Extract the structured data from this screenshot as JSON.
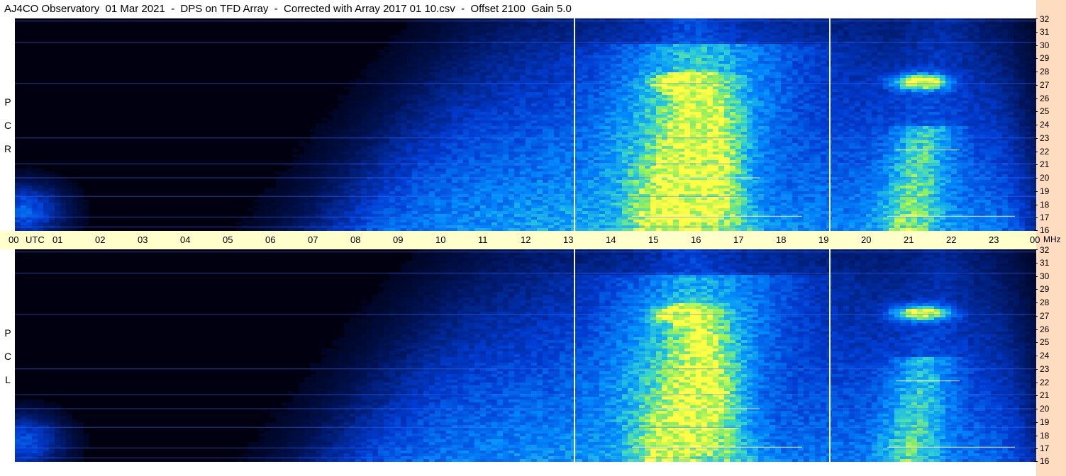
{
  "title": "AJ4CO Observatory  01 Mar 2021  -  DPS on TFD Array  -  Corrected with Array 2017 01 10.csv  -  Offset 2100  Gain 5.0",
  "chart_data": [
    {
      "type": "heatmap",
      "panel": "RCP",
      "polarization_label": [
        "R",
        "C",
        "P"
      ],
      "x_unit": "UTC",
      "x_ticks": [
        "00",
        "01",
        "02",
        "03",
        "04",
        "05",
        "06",
        "07",
        "08",
        "09",
        "10",
        "11",
        "12",
        "13",
        "14",
        "15",
        "16",
        "17",
        "18",
        "19",
        "20",
        "21",
        "22",
        "23",
        "00"
      ],
      "x_range": [
        0,
        24
      ],
      "y_unit": "MHz",
      "y_ticks": [
        32,
        31,
        30,
        29,
        28,
        27,
        26,
        25,
        24,
        23,
        22,
        21,
        20,
        19,
        18,
        17,
        16
      ],
      "y_range": [
        16,
        32
      ],
      "colormap": [
        "#000010",
        "#001a66",
        "#0046d8",
        "#0096ff",
        "#3cd2d2",
        "#a0f060",
        "#ffff40"
      ],
      "marker_lines_utc": [
        13.15,
        19.15
      ],
      "notable_features": [
        {
          "start_utc": 14.5,
          "end_utc": 17.5,
          "peak_freq_mhz": 27
        },
        {
          "start_utc": 20.5,
          "end_utc": 22.8,
          "peak_freq_mhz": 27
        }
      ]
    },
    {
      "type": "heatmap",
      "panel": "LCP",
      "polarization_label": [
        "L",
        "C",
        "P"
      ],
      "x_unit": "UTC",
      "x_ticks": [
        "00",
        "01",
        "02",
        "03",
        "04",
        "05",
        "06",
        "07",
        "08",
        "09",
        "10",
        "11",
        "12",
        "13",
        "14",
        "15",
        "16",
        "17",
        "18",
        "19",
        "20",
        "21",
        "22",
        "23",
        "00"
      ],
      "x_range": [
        0,
        24
      ],
      "y_unit": "MHz",
      "y_ticks": [
        32,
        31,
        30,
        29,
        28,
        27,
        26,
        25,
        24,
        23,
        22,
        21,
        20,
        19,
        18,
        17,
        16
      ],
      "y_range": [
        16,
        32
      ],
      "colormap": [
        "#000010",
        "#001a66",
        "#0046d8",
        "#0096ff",
        "#3cd2d2",
        "#a0f060",
        "#ffff40"
      ],
      "marker_lines_utc": [
        13.15,
        19.15
      ],
      "notable_features": [
        {
          "start_utc": 14.5,
          "end_utc": 17.5,
          "peak_freq_mhz": 27
        },
        {
          "start_utc": 20.5,
          "end_utc": 22.8,
          "peak_freq_mhz": 27
        }
      ]
    }
  ],
  "time_axis": {
    "ticks": [
      "00",
      "01",
      "02",
      "03",
      "04",
      "05",
      "06",
      "07",
      "08",
      "09",
      "10",
      "11",
      "12",
      "13",
      "14",
      "15",
      "16",
      "17",
      "18",
      "19",
      "20",
      "21",
      "22",
      "23",
      "00"
    ],
    "utc_label": "UTC",
    "mhz_label": "MHz"
  }
}
